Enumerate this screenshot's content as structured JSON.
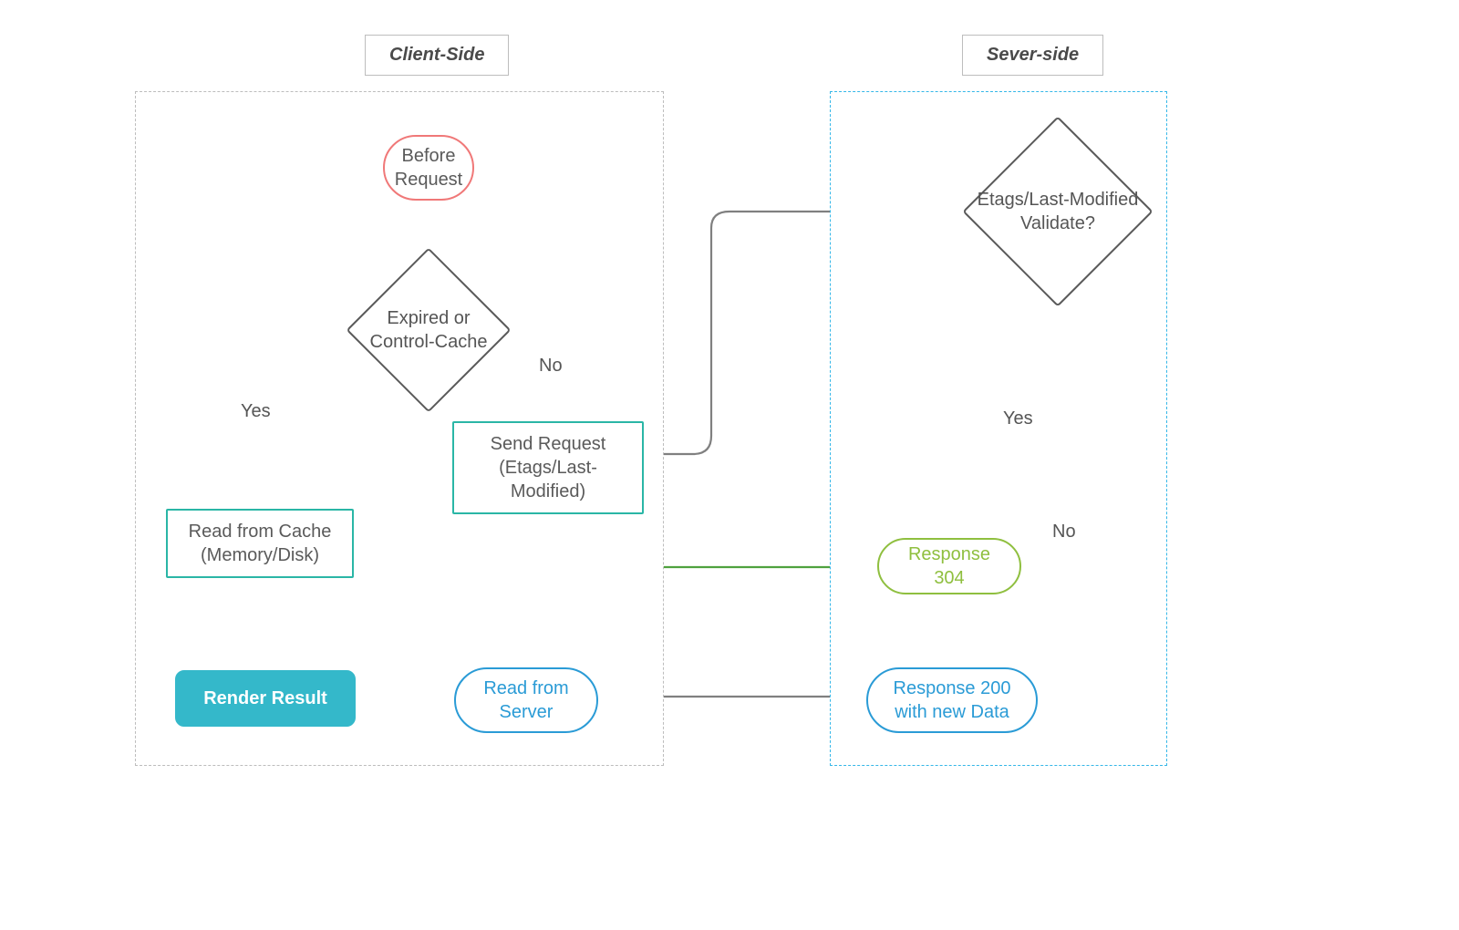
{
  "panels": {
    "client": {
      "title": "Client-Side"
    },
    "server": {
      "title": "Sever-side"
    }
  },
  "nodes": {
    "before_request": {
      "line1": "Before",
      "line2": "Request"
    },
    "expired_check": {
      "line1": "Expired or",
      "line2": "Control-Cache"
    },
    "send_request": {
      "line1": "Send Request",
      "line2": "(Etags/Last-Modified)"
    },
    "read_cache": {
      "line1": "Read from Cache",
      "line2": "(Memory/Disk)"
    },
    "render_result": {
      "line1": "Render Result"
    },
    "read_server": {
      "line1": "Read from",
      "line2": "Server"
    },
    "validate": {
      "line1": "Etags/Last-Modified",
      "line2": "Validate?"
    },
    "resp304": {
      "line1": "Response 304"
    },
    "resp200": {
      "line1": "Response 200",
      "line2": "with new Data"
    }
  },
  "edgeLabels": {
    "yes1": "Yes",
    "no1": "No",
    "yes2": "Yes",
    "no2": "No"
  },
  "colors": {
    "grey": "#808080",
    "green": "#4fa23f",
    "teal": "#2ab6a6",
    "blue": "#2a9bd6",
    "red": "#f07878",
    "olive": "#8fbf3f",
    "panelBlue": "#35b7e8"
  }
}
